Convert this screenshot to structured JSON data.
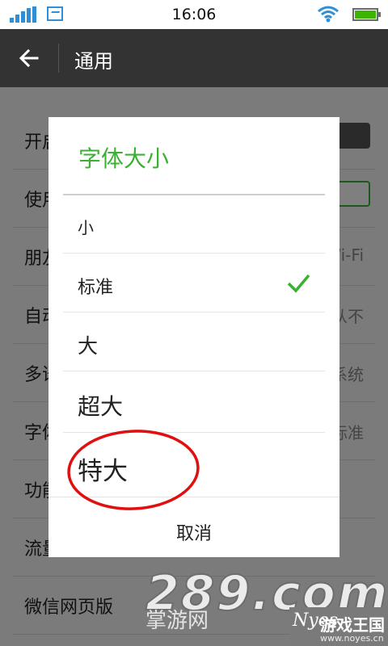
{
  "status_bar": {
    "time": "16:06",
    "signal_icon": "signal-bars-icon",
    "image_icon": "picture-icon",
    "wifi_icon": "wifi-icon",
    "battery_icon": "battery-icon",
    "battery_level": 1.0,
    "accent": "#2f8fd6"
  },
  "header": {
    "title": "通用",
    "back_icon": "back-arrow-icon",
    "background": "#333333"
  },
  "settings_list": {
    "rows": [
      {
        "label": "开启",
        "control": "toggle-on"
      },
      {
        "label": "使用",
        "control": "toggle-off"
      },
      {
        "label": "朋友",
        "value": "Wi-Fi"
      },
      {
        "label": "自动",
        "value": "从不"
      },
      {
        "label": "多语",
        "value": "跟随系统"
      },
      {
        "label": "字体",
        "value": "标准"
      },
      {
        "label": "功能"
      },
      {
        "label": "流量"
      },
      {
        "label": "微信网页版"
      }
    ]
  },
  "dialog": {
    "title": "字体大小",
    "title_color": "#3cb034",
    "options": [
      {
        "label": "小"
      },
      {
        "label": "标准",
        "selected": true
      },
      {
        "label": "大"
      },
      {
        "label": "超大"
      },
      {
        "label": "特大"
      }
    ],
    "check_icon": "checkmark-icon",
    "cancel_label": "取消"
  },
  "annotation": {
    "color": "#e01010",
    "target": "特大"
  },
  "watermark": {
    "site_big": "289.com",
    "site_small": "掌游网",
    "badge_name": "游戏王国",
    "badge_url": "www.noyes.cn",
    "badge_logo": "Nyes"
  }
}
